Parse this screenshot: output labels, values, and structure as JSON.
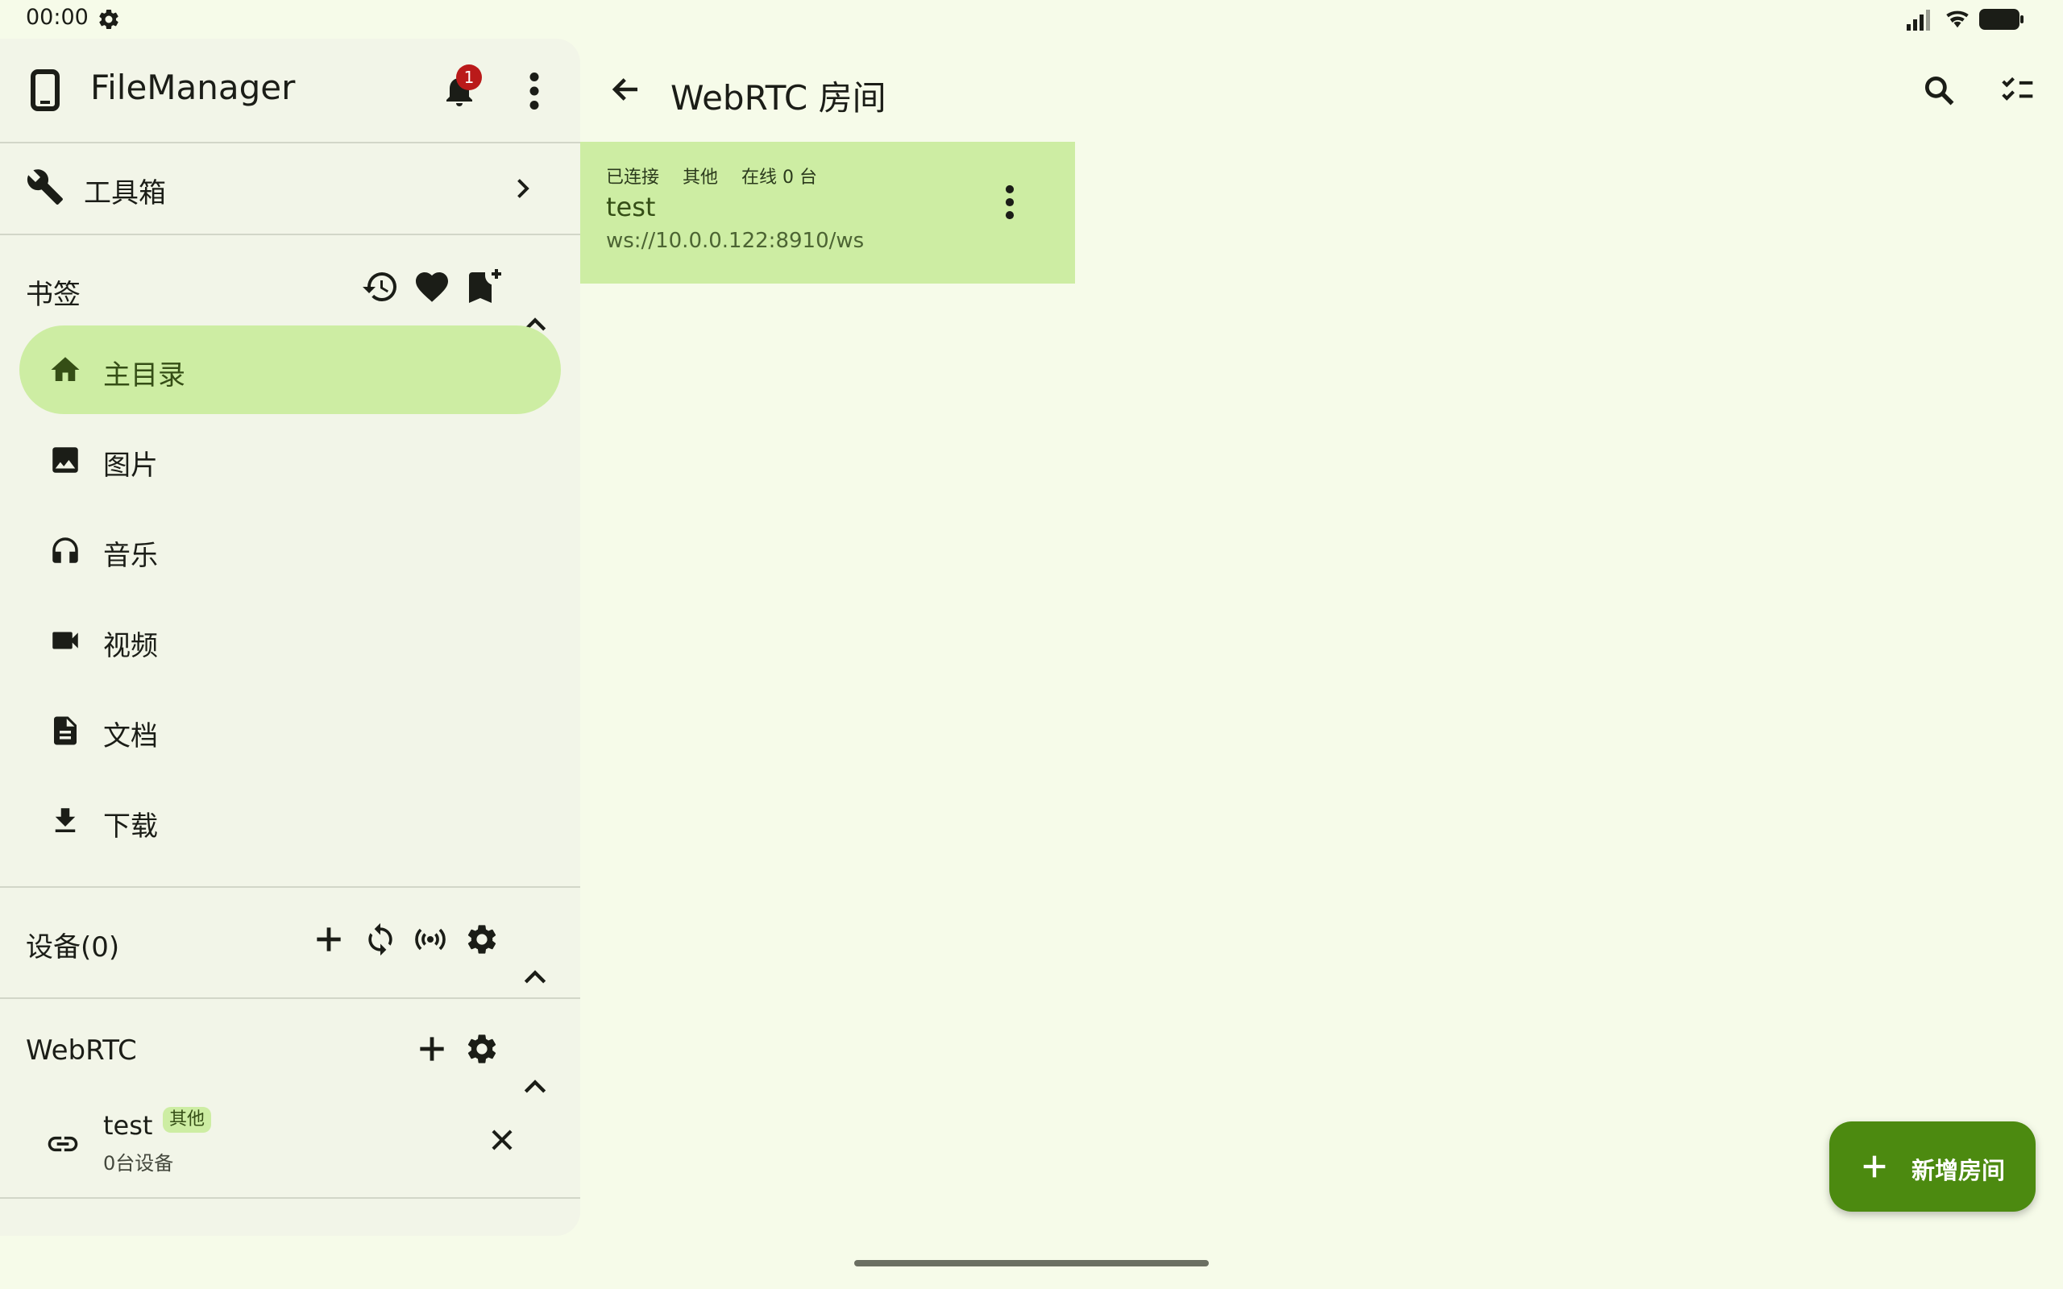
{
  "status_bar": {
    "time": "00:00"
  },
  "drawer": {
    "app_title": "FileManager",
    "notification_count": "1",
    "toolbox_label": "工具箱",
    "bookmarks": {
      "title": "书签",
      "items": [
        {
          "label": "主目录",
          "icon": "home-icon",
          "active": true
        },
        {
          "label": "图片",
          "icon": "image-icon"
        },
        {
          "label": "音乐",
          "icon": "headphones-icon"
        },
        {
          "label": "视频",
          "icon": "videocam-icon"
        },
        {
          "label": "文档",
          "icon": "document-icon"
        },
        {
          "label": "下载",
          "icon": "download-icon"
        }
      ]
    },
    "devices": {
      "title": "设备(0)"
    },
    "webrtc": {
      "title": "WebRTC",
      "rooms": [
        {
          "name": "test",
          "tag": "其他",
          "subtitle": "0台设备"
        }
      ]
    }
  },
  "main": {
    "title": "WebRTC 房间",
    "rooms": [
      {
        "status": "已连接",
        "type": "其他",
        "online": "在线 0 台",
        "name": "test",
        "url": "ws://10.0.0.122:8910/ws"
      }
    ],
    "fab_label": "新增房间"
  },
  "colors": {
    "background": "#f6fbe9",
    "drawer": "#f2f5e8",
    "accent_container": "#cdeda3",
    "primary": "#4c8a10",
    "badge": "#ba1a1a"
  }
}
